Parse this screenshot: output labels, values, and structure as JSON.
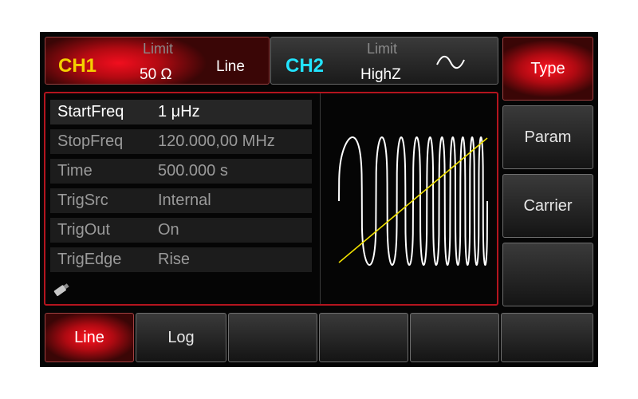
{
  "channels": {
    "ch1": {
      "label": "CH1",
      "limit": "Limit",
      "impedance": "50 Ω",
      "mode": "Line"
    },
    "ch2": {
      "label": "CH2",
      "limit": "Limit",
      "impedance": "HighZ",
      "waveform_icon": "sine-wave-icon"
    }
  },
  "softkeys_right": [
    {
      "label": "Type",
      "active": true
    },
    {
      "label": "Param",
      "active": false
    },
    {
      "label": "Carrier",
      "active": false
    },
    {
      "label": "",
      "active": false
    }
  ],
  "params": [
    {
      "name": "StartFreq",
      "value": "1 μHz",
      "selected": true
    },
    {
      "name": "StopFreq",
      "value": "120.000,00 MHz",
      "selected": false
    },
    {
      "name": "Time",
      "value": "500.000 s",
      "selected": false
    },
    {
      "name": "TrigSrc",
      "value": "Internal",
      "selected": false
    },
    {
      "name": "TrigOut",
      "value": "On",
      "selected": false
    },
    {
      "name": "TrigEdge",
      "value": "Rise",
      "selected": false
    }
  ],
  "status_icons": [
    "usb-drive-icon"
  ],
  "softkeys_bottom": [
    {
      "label": "Line",
      "active": true
    },
    {
      "label": "Log",
      "active": false
    },
    {
      "label": "",
      "active": false
    },
    {
      "label": "",
      "active": false
    },
    {
      "label": "",
      "active": false
    },
    {
      "label": "",
      "active": false
    }
  ],
  "colors": {
    "ch1_label": "#f4d000",
    "ch2_label": "#22e4ff",
    "active_red": "#e0101c",
    "sweep_line": "#f0e000",
    "waveform": "#ffffff"
  }
}
